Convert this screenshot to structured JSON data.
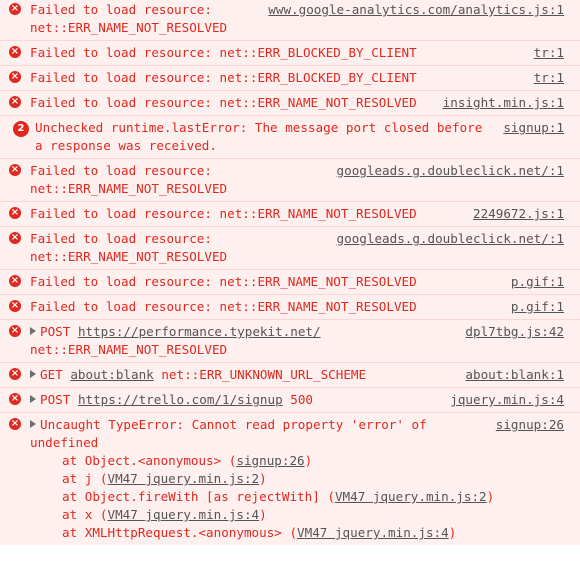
{
  "console": {
    "entries": [
      {
        "message": "Failed to load resource: net::ERR_NAME_NOT_RESOLVED",
        "source": "www.google-analytics.com/analytics.js:1"
      },
      {
        "message": "Failed to load resource: net::ERR_BLOCKED_BY_CLIENT",
        "source": "tr:1"
      },
      {
        "message": "Failed to load resource: net::ERR_BLOCKED_BY_CLIENT",
        "source": "tr:1"
      },
      {
        "message": "Failed to load resource: net::ERR_NAME_NOT_RESOLVED",
        "source": "insight.min.js:1"
      },
      {
        "badge": "2",
        "message": "Unchecked runtime.lastError: The message port closed before a response was received.",
        "source": "signup:1"
      },
      {
        "message": "Failed to load resource: net::ERR_NAME_NOT_RESOLVED",
        "source": "googleads.g.doubleclick.net/:1"
      },
      {
        "message": "Failed to load resource: net::ERR_NAME_NOT_RESOLVED",
        "source": "2249672.js:1"
      },
      {
        "message": "Failed to load resource: net::ERR_NAME_NOT_RESOLVED",
        "source": "googleads.g.doubleclick.net/:1"
      },
      {
        "message": "Failed to load resource: net::ERR_NAME_NOT_RESOLVED",
        "source": "p.gif:1"
      },
      {
        "message": "Failed to load resource: net::ERR_NAME_NOT_RESOLVED",
        "source": "p.gif:1"
      },
      {
        "method": "POST",
        "url": "https://performance.typekit.net/",
        "message": "net::ERR_NAME_NOT_RESOLVED",
        "source": "dpl7tbg.js:42"
      },
      {
        "method": "GET",
        "url": "about:blank",
        "message": "net::ERR_UNKNOWN_URL_SCHEME",
        "source": "about:blank:1"
      },
      {
        "method": "POST",
        "url": "https://trello.com/1/signup",
        "message": "500",
        "source": "jquery.min.js:4"
      },
      {
        "message": "Uncaught TypeError: Cannot read property 'error' of undefined",
        "source": "signup:26"
      }
    ],
    "stack_trace": [
      {
        "prefix": "at Object.<anonymous> (",
        "link": "signup:26",
        "suffix": ")"
      },
      {
        "prefix": "at j (",
        "link": "VM47 jquery.min.js:2",
        "suffix": ")"
      },
      {
        "prefix": "at Object.fireWith [as rejectWith] (",
        "link": "VM47 jquery.min.js:2",
        "suffix": ")"
      },
      {
        "prefix": "at x (",
        "link": "VM47 jquery.min.js:4",
        "suffix": ")"
      },
      {
        "prefix": "at XMLHttpRequest.<anonymous> (",
        "link": "VM47 jquery.min.js:4",
        "suffix": ")"
      }
    ],
    "icons": {
      "error": "error-icon",
      "expand": "expand-triangle-icon"
    },
    "colors": {
      "error_text": "#e0281e",
      "error_background": "#fff0f0",
      "error_border": "#ffd6d6",
      "link": "#545454"
    }
  }
}
